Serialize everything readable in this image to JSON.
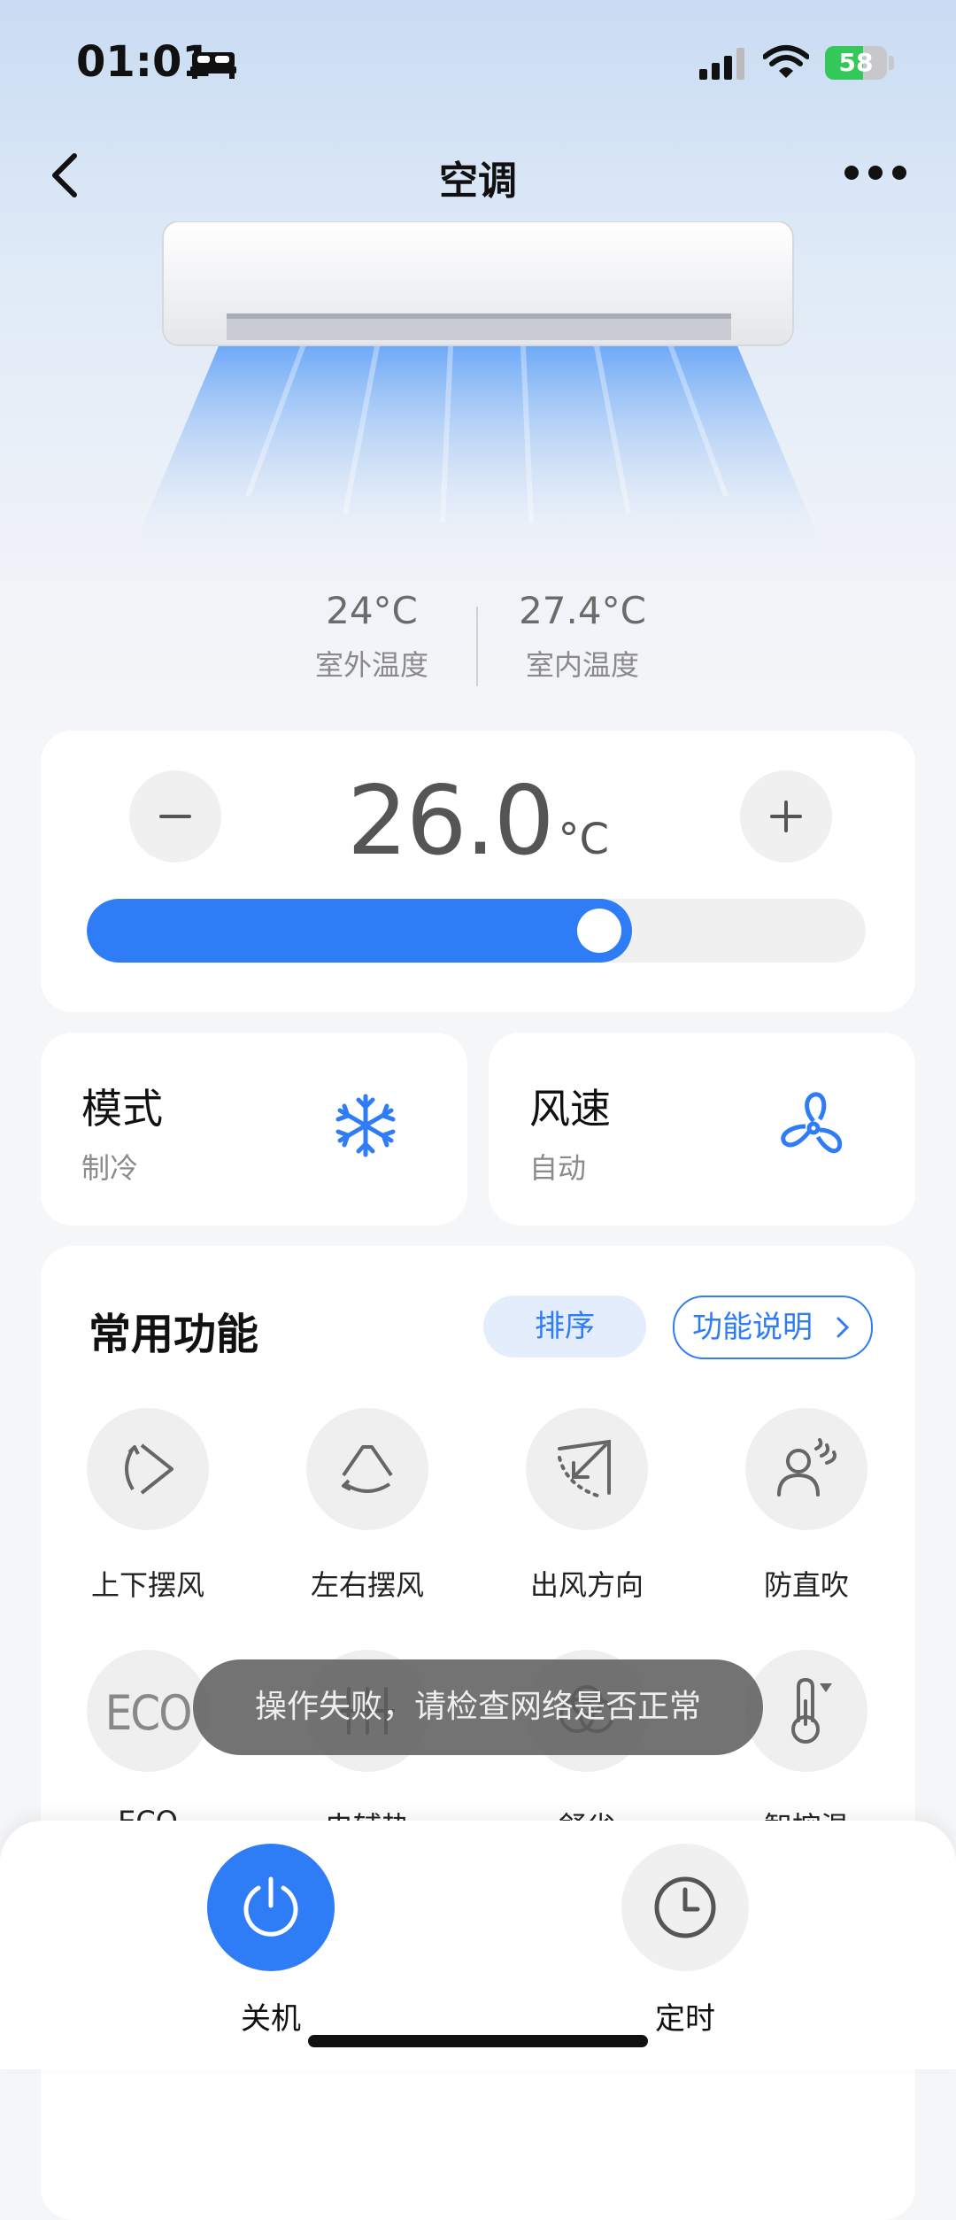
{
  "status_bar": {
    "time": "01:01",
    "battery": "58"
  },
  "navbar": {
    "title": "空调"
  },
  "temps": {
    "outdoor": {
      "value": "24°C",
      "label": "室外温度"
    },
    "indoor": {
      "value": "27.4°C",
      "label": "室内温度"
    }
  },
  "setpoint": {
    "value": "26.0",
    "unit": "°C",
    "slider_fraction": 0.7
  },
  "controls": {
    "mode": {
      "title": "模式",
      "value": "制冷",
      "icon": "snowflake-icon"
    },
    "fan": {
      "title": "风速",
      "value": "自动",
      "icon": "fan-icon"
    }
  },
  "functions": {
    "title": "常用功能",
    "sort_label": "排序",
    "explain_label": "功能说明",
    "items": [
      {
        "label": "上下摆风",
        "icon": "vertical-swing-icon"
      },
      {
        "label": "左右摆风",
        "icon": "horizontal-swing-icon"
      },
      {
        "label": "出风方向",
        "icon": "air-direction-icon"
      },
      {
        "label": "防直吹",
        "icon": "anti-direct-blow-icon"
      },
      {
        "label": "ECO",
        "icon": "eco-icon",
        "icon_text": "ECO"
      },
      {
        "label": "电辅热",
        "icon": "electric-heat-icon"
      },
      {
        "label": "舒省",
        "icon": "comfort-save-icon"
      },
      {
        "label": "智控温",
        "icon": "smart-temp-icon"
      }
    ]
  },
  "toast": "操作失败，请检查网络是否正常",
  "bottom": {
    "power_label": "关机",
    "timer_label": "定时"
  },
  "colors": {
    "accent": "#2f7df6"
  }
}
